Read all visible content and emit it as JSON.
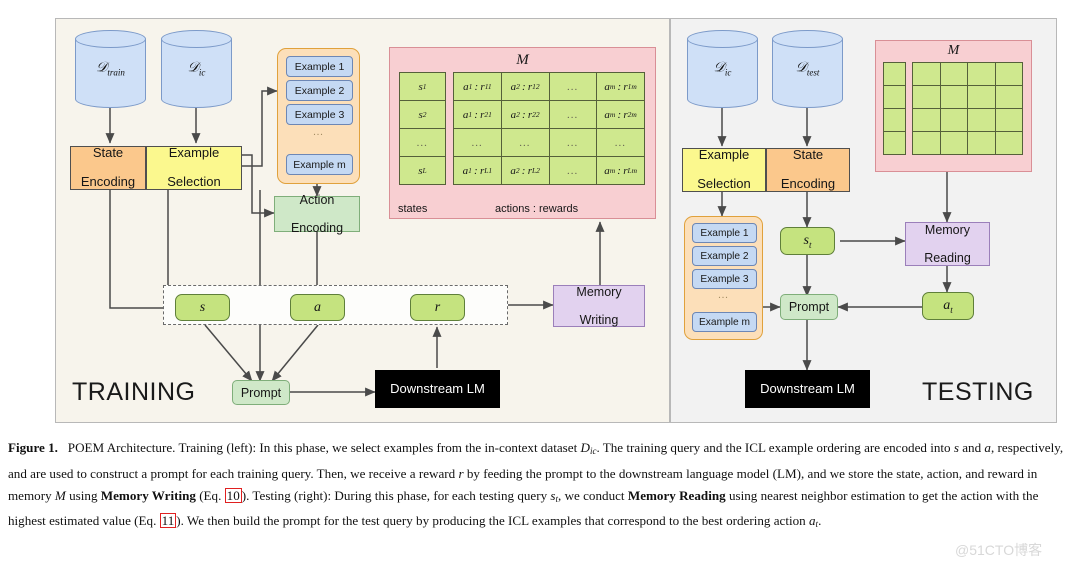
{
  "figure": {
    "training_label": "TRAINING",
    "testing_label": "TESTING"
  },
  "training": {
    "datastores": [
      {
        "name": "d-train",
        "base": "D",
        "sub": "train"
      },
      {
        "name": "d-ic",
        "base": "D",
        "sub": "ic"
      }
    ],
    "state_encoding": [
      "State",
      "Encoding"
    ],
    "example_selection": [
      "Example",
      "Selection"
    ],
    "action_encoding": [
      "Action",
      "Encoding"
    ],
    "examples": [
      "Example 1",
      "Example 2",
      "Example 3",
      "...",
      "Example m"
    ],
    "sar": {
      "state": "s",
      "action": "a",
      "reward": "r"
    },
    "prompt": "Prompt",
    "downstream_lm": "Downstream LM",
    "memory_writing": [
      "Memory",
      "Writing"
    ]
  },
  "memory_training": {
    "title": "M",
    "states_caption": "states",
    "actions_caption": "actions : rewards",
    "states": [
      "s1",
      "s2",
      "...",
      "sL"
    ],
    "states_sub": [
      "1",
      "2",
      "",
      "L"
    ],
    "rows": [
      [
        "a1 : r11",
        "a2 : r12",
        "...",
        "am : r1m"
      ],
      [
        "a1 : r21",
        "a2 : r22",
        "...",
        "am : r2m"
      ],
      [
        "...",
        "...",
        "...",
        "..."
      ],
      [
        "a1 : rL1",
        "a2 : rL2",
        "...",
        "am : rLm"
      ]
    ],
    "cells_structured": [
      [
        {
          "a": "a",
          "as": "1",
          "r": "r",
          "rs": "11"
        },
        {
          "a": "a",
          "as": "2",
          "r": "r",
          "rs": "12"
        },
        {
          "dots": true
        },
        {
          "a": "a",
          "as": "m",
          "r": "r",
          "rs": "1m"
        }
      ],
      [
        {
          "a": "a",
          "as": "1",
          "r": "r",
          "rs": "21"
        },
        {
          "a": "a",
          "as": "2",
          "r": "r",
          "rs": "22"
        },
        {
          "dots": true
        },
        {
          "a": "a",
          "as": "m",
          "r": "r",
          "rs": "2m"
        }
      ],
      [
        {
          "dots": true
        },
        {
          "dots": true
        },
        {
          "dots": true
        },
        {
          "dots": true
        }
      ],
      [
        {
          "a": "a",
          "as": "1",
          "r": "r",
          "rs": "L1"
        },
        {
          "a": "a",
          "as": "2",
          "r": "r",
          "rs": "L2"
        },
        {
          "dots": true
        },
        {
          "a": "a",
          "as": "m",
          "r": "r",
          "rs": "Lm"
        }
      ]
    ]
  },
  "memory_testing": {
    "title": "M",
    "state_cells": 4,
    "grid_rows": 4,
    "grid_cols": 4
  },
  "testing": {
    "datastores": [
      {
        "name": "d-ic",
        "base": "D",
        "sub": "ic"
      },
      {
        "name": "d-test",
        "base": "D",
        "sub": "test"
      }
    ],
    "example_selection": [
      "Example",
      "Selection"
    ],
    "state_encoding": [
      "State",
      "Encoding"
    ],
    "examples": [
      "Example 1",
      "Example 2",
      "Example 3",
      "...",
      "Example m"
    ],
    "state_t": {
      "base": "s",
      "sub": "t"
    },
    "action_t": {
      "base": "a",
      "sub": "t"
    },
    "memory_reading": [
      "Memory",
      "Reading"
    ],
    "prompt": "Prompt",
    "downstream_lm": "Downstream LM"
  },
  "caption": {
    "figure_number": "Figure 1.",
    "part1": "POEM Architecture. Training (left): In this phase, we select examples from the in-context dataset ",
    "dic": "D",
    "dic_sub": "ic",
    "part2": ". The training query and the ICL example ordering are encoded into ",
    "s": "s",
    "part3": " and ",
    "a": "a",
    "part4": ", respectively, and are used to construct a prompt for each training query. Then, we receive a reward ",
    "r": "r",
    "part5": " by feeding the prompt to the downstream language model (LM), and we store the state, action, and reward in memory ",
    "memsym": "M",
    "part6": " using ",
    "bold1": "Memory Writing",
    "part7": " (Eq. ",
    "eq10": "10",
    "part8": "). Testing (right): During this phase, for each testing query ",
    "st": "s",
    "st_sub": "t",
    "part9": ", we conduct ",
    "bold2": "Memory Reading",
    "part10": " using nearest neighbor estimation to get the action with the highest estimated value (Eq. ",
    "eq11": "11",
    "part11": "). We then build the prompt for the test query by producing the ICL examples that correspond to the best ordering action ",
    "at": "a",
    "at_sub": "t",
    "part12": "."
  },
  "watermark": "@51CTO博客",
  "colors": {
    "training_bg": "#f7f4ec",
    "testing_bg": "#f2f2f2",
    "orange": "#fbc88c",
    "yellow": "#fbf88e",
    "green_light": "#cfe8c8",
    "green_bright": "#c5e37f",
    "purple": "#e2d2ef",
    "pink_panel": "#f8cfd2",
    "orange_panel": "#fcdfb9",
    "example_box": "#c5d9f3",
    "cylinder": "#cfe0f7",
    "black_box": "#000000",
    "eqref_border": "#e02020"
  }
}
